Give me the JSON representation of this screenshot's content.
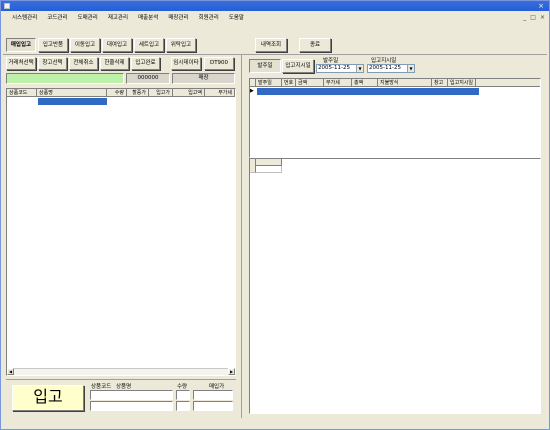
{
  "menu": [
    "시스템관리",
    "코드관리",
    "도매관리",
    "재고관리",
    "매출분석",
    "매장관리",
    "회원관리",
    "도움말"
  ],
  "mdi_controls": [
    "_",
    "□",
    "×"
  ],
  "left_tabs": [
    "매입입고",
    "입고반품",
    "이동입고",
    "대여입고",
    "세트입고",
    "위탁입고"
  ],
  "right_top_buttons": [
    "내역조회",
    "종료"
  ],
  "action_buttons": [
    "거래처선택",
    "창고선택",
    "전체취소",
    "한줄삭제",
    "입고완료",
    "임시데이타",
    "DT900"
  ],
  "info_row": {
    "code": "000000",
    "label": "매장"
  },
  "product_grid": {
    "columns": [
      "상품코드",
      "상품명",
      "수량",
      "할증가",
      "입고가",
      "입고액",
      "부가세"
    ]
  },
  "bottom": {
    "big_label": "입고",
    "field_labels": [
      "상품코드",
      "상품명",
      "수량",
      "매입가"
    ]
  },
  "right": {
    "tabs": [
      "발주일",
      "입고지시일"
    ],
    "order_date_label": "발주일",
    "order_date": "2005-11-25",
    "instruct_date_label": "입고지시일",
    "instruct_date": "2005-11-25",
    "grid_columns": [
      "발주일",
      "번호",
      "금액",
      "부가세",
      "총액",
      "지불방식",
      "창고",
      "입고지시일"
    ]
  }
}
